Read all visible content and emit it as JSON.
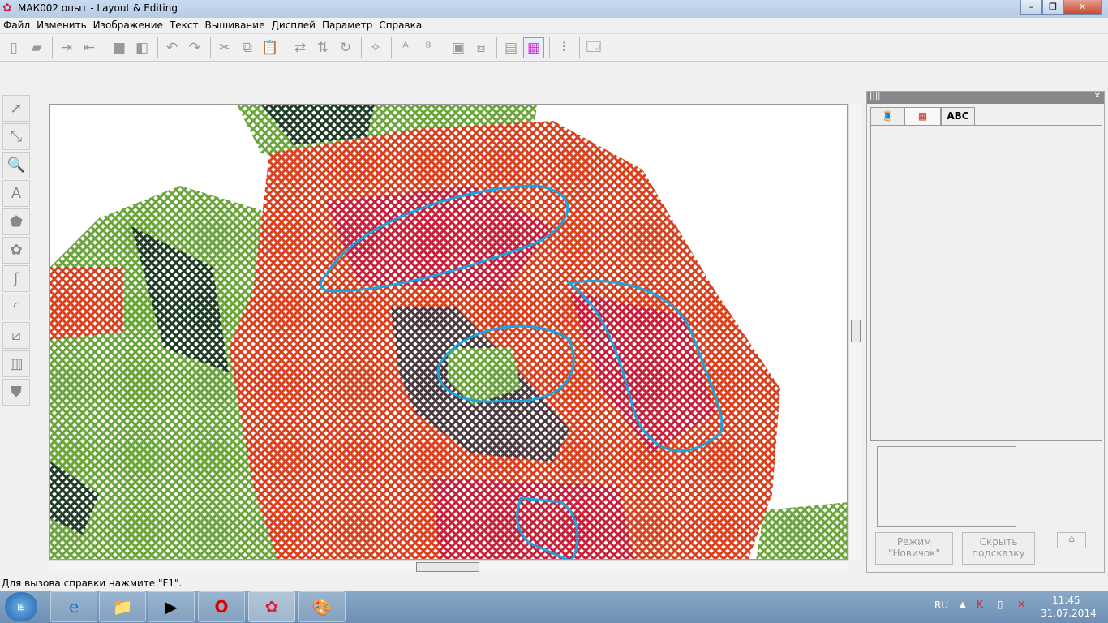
{
  "window": {
    "title": "МАК002 опыт - Layout & Editing",
    "min": "–",
    "max": "❐",
    "close": "✕"
  },
  "menu": [
    "Файл",
    "Изменить",
    "Изображение",
    "Текст",
    "Вышивание",
    "Дисплей",
    "Параметр",
    "Справка"
  ],
  "panel": {
    "tab3": "ABC",
    "btn_mode": "Режим \"Новичок\"",
    "btn_hide": "Скрыть подсказку"
  },
  "status": "Для вызова справки нажмите \"F1\".",
  "tray": {
    "lang": "RU",
    "time": "11:45",
    "date": "31.07.2014"
  },
  "colors": {
    "red": "#d8401e",
    "green": "#6aa53a",
    "darkgreen": "#1f3d26",
    "outline": "#1aa3e0"
  }
}
